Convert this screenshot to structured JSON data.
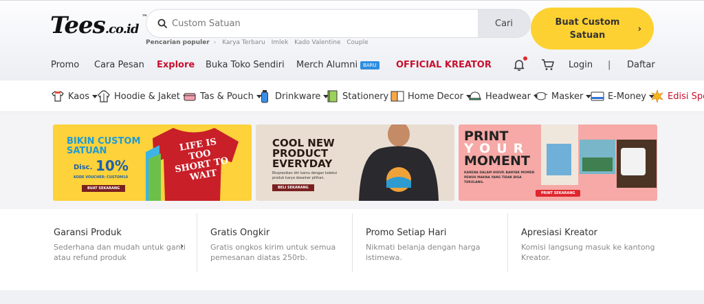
{
  "logo": {
    "text": "Tees",
    "domain": ".co.id",
    "tm": "™"
  },
  "search": {
    "placeholder": "Custom Satuan",
    "button": "Cari"
  },
  "custom_button": {
    "label_line1": "Buat Custom",
    "label_line2": "Satuan"
  },
  "popular": {
    "label": "Pencarian populer",
    "terms": [
      "Karya Terbaru",
      "Imlek",
      "Kado Valentine",
      "Couple"
    ]
  },
  "nav": {
    "promo": "Promo",
    "cara_pesan": "Cara Pesan",
    "explore": "Explore",
    "buka_toko": "Buka Toko Sendiri",
    "merch_alumni": "Merch Alumni",
    "baru_badge": "BARU",
    "official_kreator": "OFFICIAL KREATOR",
    "login": "Login",
    "divider": "|",
    "daftar": "Daftar"
  },
  "categories": [
    "Kaos",
    "Hoodie & Jaket",
    "Tas & Pouch",
    "Drinkware",
    "Stationery",
    "Home Decor",
    "Headwear",
    "Masker",
    "E-Money",
    "Edisi Spe"
  ],
  "banners": {
    "b1": {
      "title1": "BIKIN CUSTOM",
      "title2": "SATUAN",
      "disc_label": "Disc.",
      "disc_value": "10%",
      "voucher": "KODE VOUCHER: CUSTOM10",
      "cta": "BUAT SEKARANG",
      "shirt_text": "LIFE IS TOO SHORT TO WAIT"
    },
    "b2": {
      "title1": "COOL NEW",
      "title2": "PRODUCT",
      "title3": "EVERYDAY",
      "desc": "Ekspresikan diri kamu dengan koleksi produk karya desainer pilihan.",
      "cta": "BELI SEKARANG"
    },
    "b3": {
      "title1": "PRINT",
      "title2": "YOUR",
      "title3": "MOMENT",
      "desc": "KARENA DALAM HIDUP, BANYAK MOMEN PENUH MAKNA YANG TIDAK BISA TERULANG.",
      "cta": "PRINT SEKARANG"
    }
  },
  "features": [
    {
      "title": "Garansi Produk",
      "desc": "Sederhana dan mudah untuk ganti atau refund produk"
    },
    {
      "title": "Gratis Ongkir",
      "desc": "Gratis ongkos kirim untuk semua pemesanan diatas 250rb."
    },
    {
      "title": "Promo Setiap Hari",
      "desc": "Nikmati belanja dengan harga istimewa."
    },
    {
      "title": "Apresiasi Kreator",
      "desc": "Komisi langsung masuk ke kantong Kreator."
    }
  ],
  "colors": {
    "accent_yellow": "#fdd131",
    "brand_red": "#c8102e",
    "badge_blue": "#2f8ee0"
  },
  "icons": [
    "search-icon",
    "bell-icon",
    "cart-icon",
    "chevron-right-icon"
  ]
}
